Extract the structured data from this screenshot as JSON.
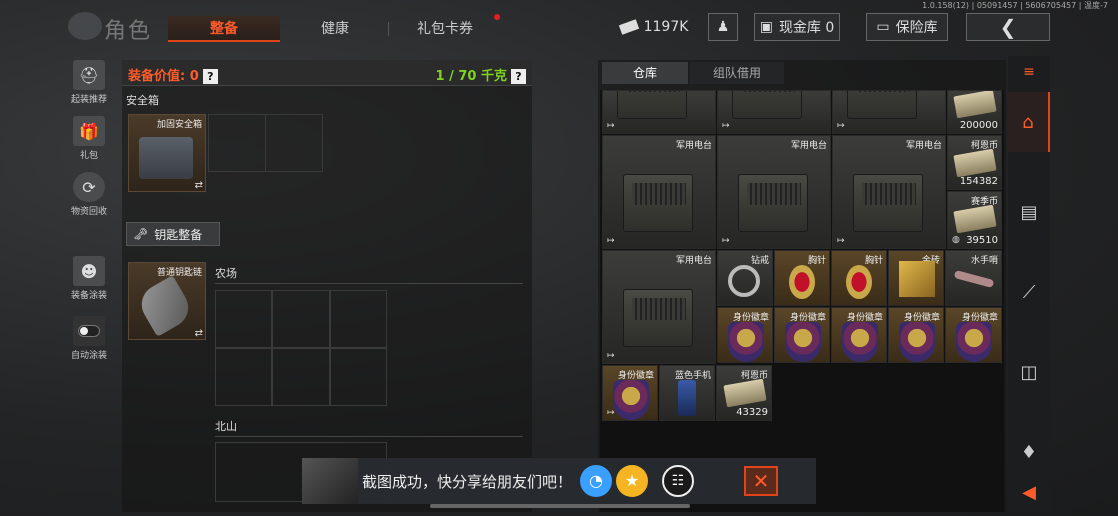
{
  "version": "1.0.158(12) | 05091457 | 5606705457 | 温度-7",
  "header": {
    "title": "角色",
    "tabs": [
      "整备",
      "健康",
      "礼包卡券"
    ],
    "money": "1197K",
    "cash_storage": "现金库 0",
    "safe": "保险库"
  },
  "sidebar": [
    "起装推荐",
    "礼包",
    "物资回收",
    "装备涂装",
    "自动涂装"
  ],
  "gear": {
    "value_label": "装备价值: 0",
    "weight": "1 / 70 千克",
    "safe_box_label": "安全箱",
    "safe_box_item": "加固安全箱",
    "key_gear_btn": "钥匙整备",
    "keychain_item": "普通钥匙链",
    "area1": "农场",
    "area2": "北山"
  },
  "storage": {
    "tabs": [
      "仓库",
      "组队借用"
    ],
    "row0_count": "200000",
    "radio": "军用电台",
    "koin_label": "柯恩币",
    "koin_count1": "154382",
    "season_label": "赛季币",
    "season_count": "39510",
    "diamond_ring": "钻戒",
    "brooch": "胸针",
    "gold": "金砖",
    "whistle": "水手哨",
    "badge": "身份徽章",
    "blue_phone": "蓝色手机",
    "koin_count2": "43329"
  },
  "toast": {
    "text": "截图成功，快分享给朋友们吧！"
  }
}
